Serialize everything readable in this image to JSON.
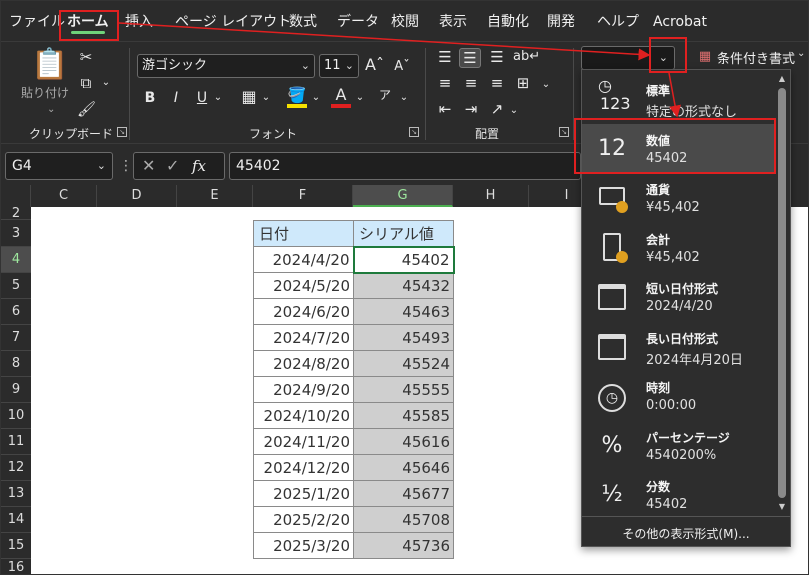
{
  "menu": {
    "items": [
      "ファイル",
      "ホーム",
      "挿入",
      "ページ レイアウト",
      "数式",
      "データ",
      "校閲",
      "表示",
      "自動化",
      "開発",
      "ヘルプ",
      "Acrobat"
    ],
    "active": "ホーム"
  },
  "ribbon": {
    "clipboard": {
      "paste_label": "貼り付け",
      "group_label": "クリップボード"
    },
    "font": {
      "font_name": "游ゴシック",
      "font_size": "11",
      "group_label": "フォント",
      "bold": "B",
      "italic": "I",
      "underline": "U",
      "phonetic": "ア"
    },
    "alignment": {
      "group_label": "配置"
    },
    "number": {
      "format_value": ""
    },
    "styles": {
      "conditional_label": "条件付き書式"
    }
  },
  "formula_bar": {
    "name_box": "G4",
    "fx": "fx",
    "value": "45402"
  },
  "columns": [
    "C",
    "D",
    "E",
    "F",
    "G",
    "H",
    "I"
  ],
  "selected_column": "G",
  "rows": [
    "2",
    "3",
    "4",
    "5",
    "6",
    "7",
    "8",
    "9",
    "10",
    "11",
    "12",
    "13",
    "14",
    "15",
    "16"
  ],
  "table": {
    "headers": [
      "日付",
      "シリアル値"
    ],
    "rows": [
      [
        "2024/4/20",
        "45402"
      ],
      [
        "2024/5/20",
        "45432"
      ],
      [
        "2024/6/20",
        "45463"
      ],
      [
        "2024/7/20",
        "45493"
      ],
      [
        "2024/8/20",
        "45524"
      ],
      [
        "2024/9/20",
        "45555"
      ],
      [
        "2024/10/20",
        "45585"
      ],
      [
        "2024/11/20",
        "45616"
      ],
      [
        "2024/12/20",
        "45646"
      ],
      [
        "2025/1/20",
        "45677"
      ],
      [
        "2025/2/20",
        "45708"
      ],
      [
        "2025/3/20",
        "45736"
      ]
    ]
  },
  "number_formats": {
    "items": [
      {
        "name": "標準",
        "sample": "特定の形式なし",
        "icon": "general-123-icon"
      },
      {
        "name": "数値",
        "sample": "45402",
        "icon": "number-12-icon"
      },
      {
        "name": "通貨",
        "sample": "¥45,402",
        "icon": "currency-icon"
      },
      {
        "name": "会計",
        "sample": "¥45,402",
        "icon": "accounting-icon"
      },
      {
        "name": "短い日付形式",
        "sample": "2024/4/20",
        "icon": "calendar-icon"
      },
      {
        "name": "長い日付形式",
        "sample": "2024年4月20日",
        "icon": "calendar-icon"
      },
      {
        "name": "時刻",
        "sample": "0:00:00",
        "icon": "clock-icon"
      },
      {
        "name": "パーセンテージ",
        "sample": "4540200%",
        "icon": "percent-icon"
      },
      {
        "name": "分数",
        "sample": "45402",
        "icon": "fraction-icon"
      }
    ],
    "selected": "数値",
    "more_label": "その他の表示形式(M)..."
  },
  "icon_glyphs": {
    "general": "123",
    "number": "12",
    "percent": "%",
    "fraction": "½"
  },
  "colors": {
    "highlight": "#e02020",
    "selection_green": "#1e7a3c",
    "header_fill": "#cfe9fb",
    "value_fill": "#cfcfcf"
  }
}
